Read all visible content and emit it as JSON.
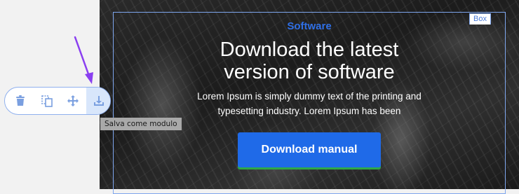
{
  "hero": {
    "eyebrow": "Software",
    "headline_line1": "Download the latest",
    "headline_line2": "version of software",
    "body_line1": "Lorem Ipsum is simply dummy text of the printing and",
    "body_line2": "typesetting industry. Lorem Ipsum has been",
    "cta_label": "Download manual"
  },
  "box": {
    "tag_label": "Box"
  },
  "toolbar": {
    "tools": [
      {
        "icon": "trash-icon",
        "active": false
      },
      {
        "icon": "duplicate-icon",
        "active": false
      },
      {
        "icon": "move-icon",
        "active": false
      },
      {
        "icon": "save-download-icon",
        "active": true
      }
    ],
    "tooltip": "Salva come modulo"
  },
  "colors": {
    "accent": "#1f6ae8",
    "eyebrow": "#2f6fe6",
    "outline": "#7ea6ee",
    "annotation_arrow": "#8a3ff0",
    "toolbar_icon": "#7a9fe0"
  }
}
